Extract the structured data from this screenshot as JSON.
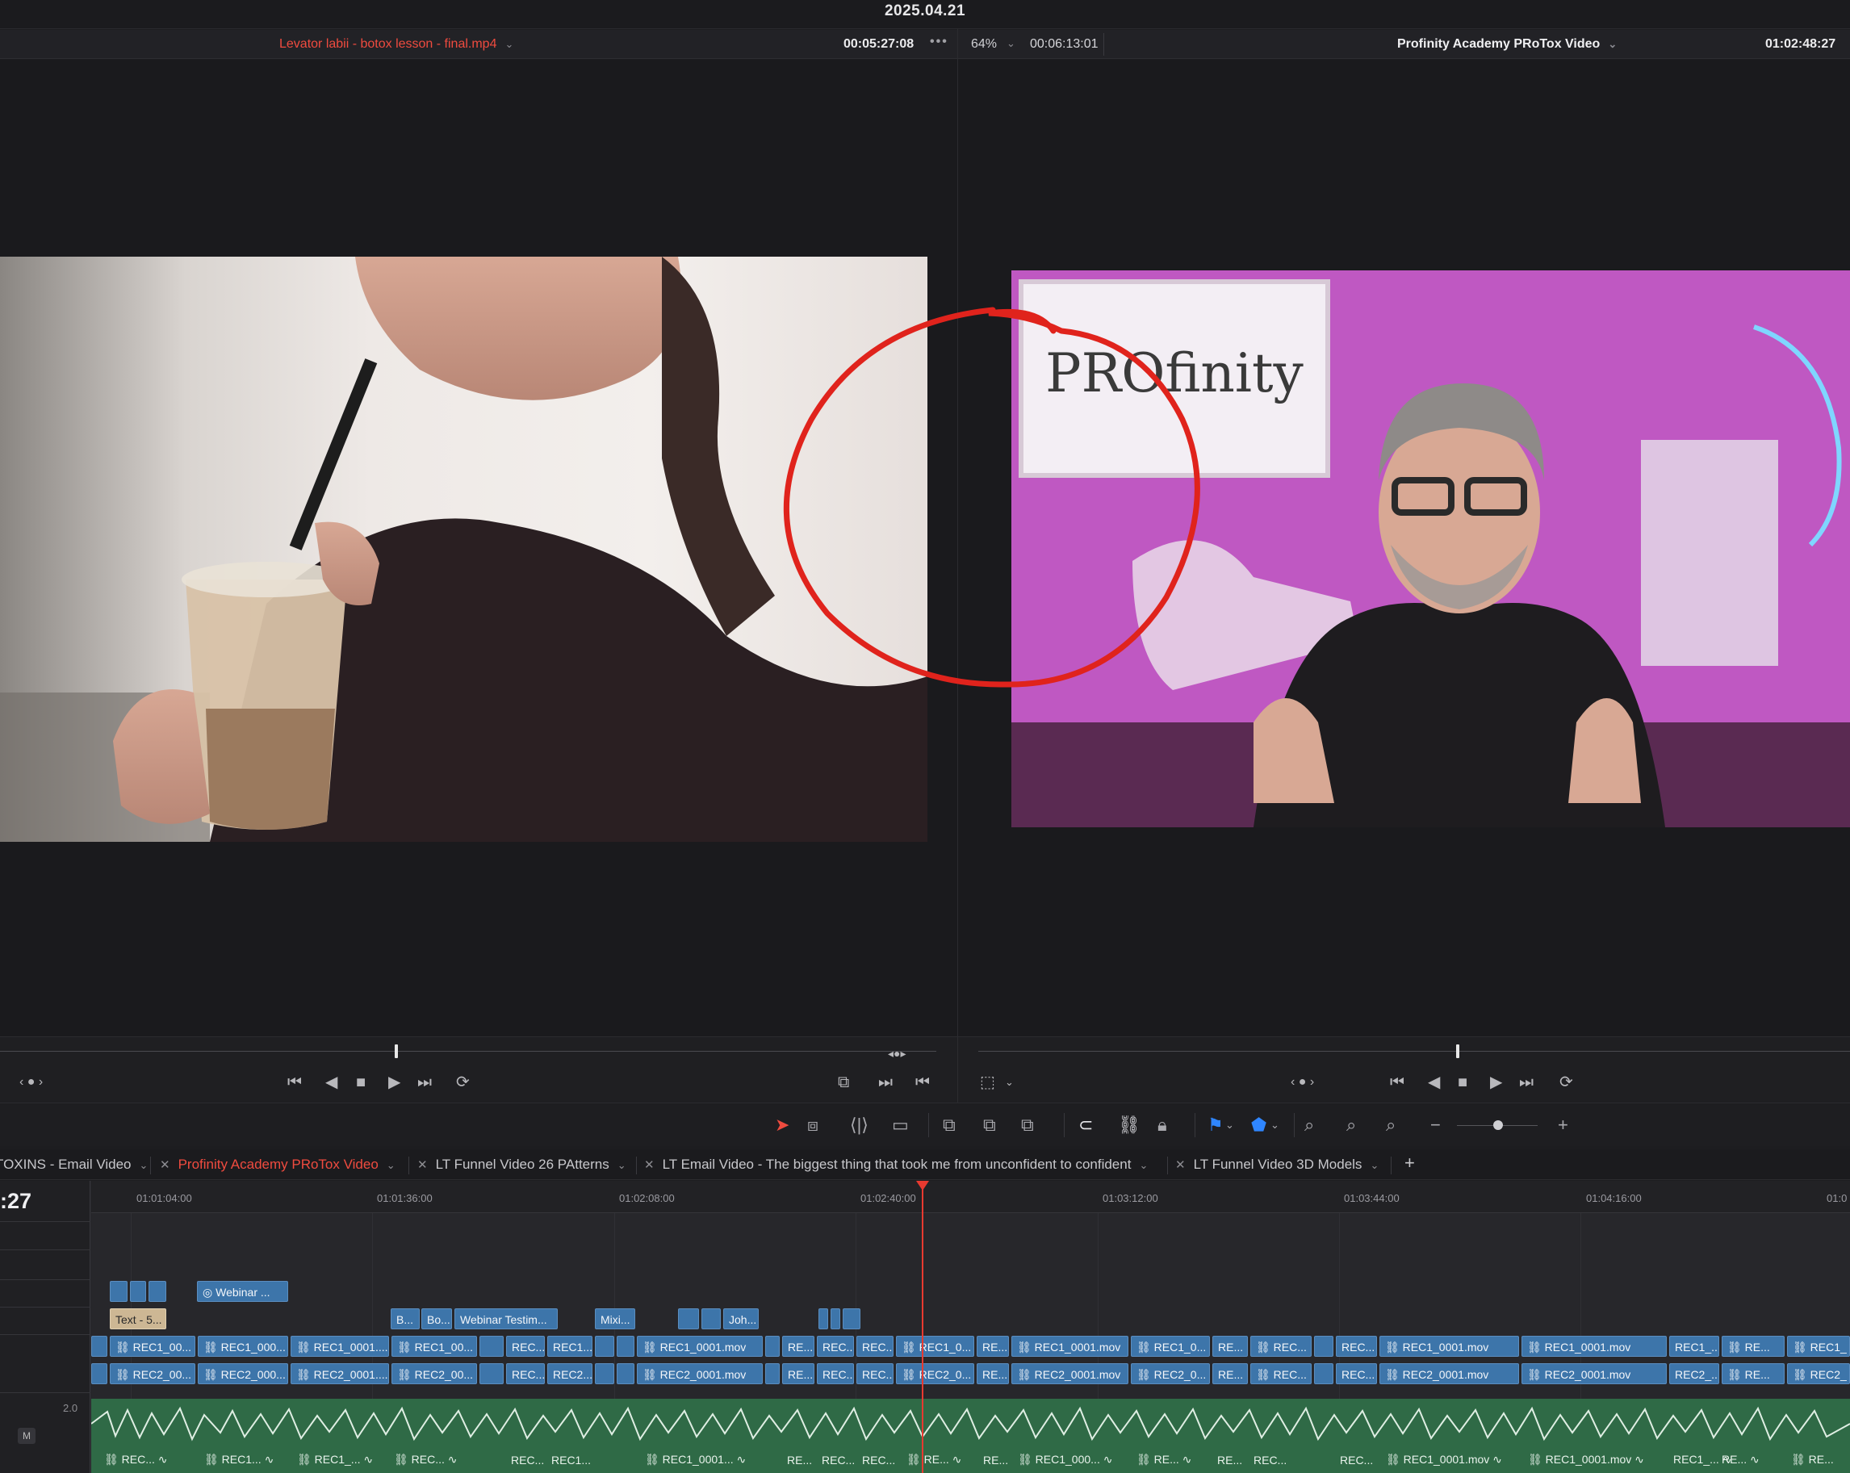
{
  "date": "2025.04.21",
  "source_viewer": {
    "clip_name": "Levator labii - botox lesson - final.mp4",
    "timecode": "00:05:27:08",
    "more_label": "•••"
  },
  "timeline_viewer": {
    "zoom": "64%",
    "duration": "00:06:13:01",
    "title": "Profinity Academy PRoTox Video",
    "timecode": "01:02:48:27"
  },
  "frame_right_logo": "PROfinity",
  "colors": {
    "accent_red": "#ef4b3f",
    "clip_blue": "#3d75aa",
    "audio_green": "#357b50",
    "playhead": "#e83a30",
    "annotation": "#e0231c"
  },
  "tabs": [
    {
      "label": "TOXINS - Email Video",
      "active": false
    },
    {
      "label": "Profinity Academy PRoTox Video",
      "active": true
    },
    {
      "label": "LT Funnel Video 26 PAtterns",
      "active": false
    },
    {
      "label": "LT Email Video - The biggest thing that took me from unconfident to confident",
      "active": false
    },
    {
      "label": "LT Funnel Video 3D Models",
      "active": false
    }
  ],
  "add_tab": "+",
  "timeline": {
    "timecode_fragment": ":27",
    "ruler": [
      "01:01:04:00",
      "01:01:36:00",
      "01:02:08:00",
      "01:02:40:00",
      "01:03:12:00",
      "01:03:44:00",
      "01:04:16:00",
      "01:0"
    ],
    "gain_value": "2.0",
    "mute_label": "M"
  },
  "clips": {
    "v5": [
      "Webinar ..."
    ],
    "v4": [
      "Text - 5...",
      "B...",
      "Bo...",
      "Webinar Testim...",
      "Mixi...",
      "Joh..."
    ],
    "v3": [
      "REC1_00...",
      "REC1_000...",
      "REC1_0001....",
      "REC1_00...",
      "REC...",
      "REC1...",
      "REC1_0001.mov",
      "RE...",
      "REC...",
      "REC...",
      "REC1_0...",
      "RE...",
      "REC1_0001.mov",
      "REC1_0...",
      "RE...",
      "REC...",
      "REC...",
      "REC1_0001.mov",
      "REC1_0001.mov",
      "REC1_...",
      "RE...",
      "REC1_"
    ],
    "v2": [
      "REC2_00...",
      "REC2_000...",
      "REC2_0001....",
      "REC2_00...",
      "REC...",
      "REC2...",
      "REC2_0001.mov",
      "RE...",
      "REC...",
      "REC...",
      "REC2_0...",
      "RE...",
      "REC2_0001.mov",
      "REC2_0...",
      "RE...",
      "REC...",
      "REC...",
      "REC2_0001.mov",
      "REC2_0001.mov",
      "REC2_...",
      "RE...",
      "REC2_"
    ],
    "a1": [
      "REC...",
      "REC1...",
      "REC1_...",
      "REC...",
      "REC...",
      "REC1...",
      "REC1_0001...",
      "RE...",
      "REC...",
      "REC...",
      "RE...",
      "RE...",
      "REC1_000...",
      "RE...",
      "RE...",
      "REC...",
      "REC...",
      "REC1_0001.mov",
      "REC1_0001.mov",
      "REC1_...",
      "RE...",
      "RE..."
    ]
  }
}
